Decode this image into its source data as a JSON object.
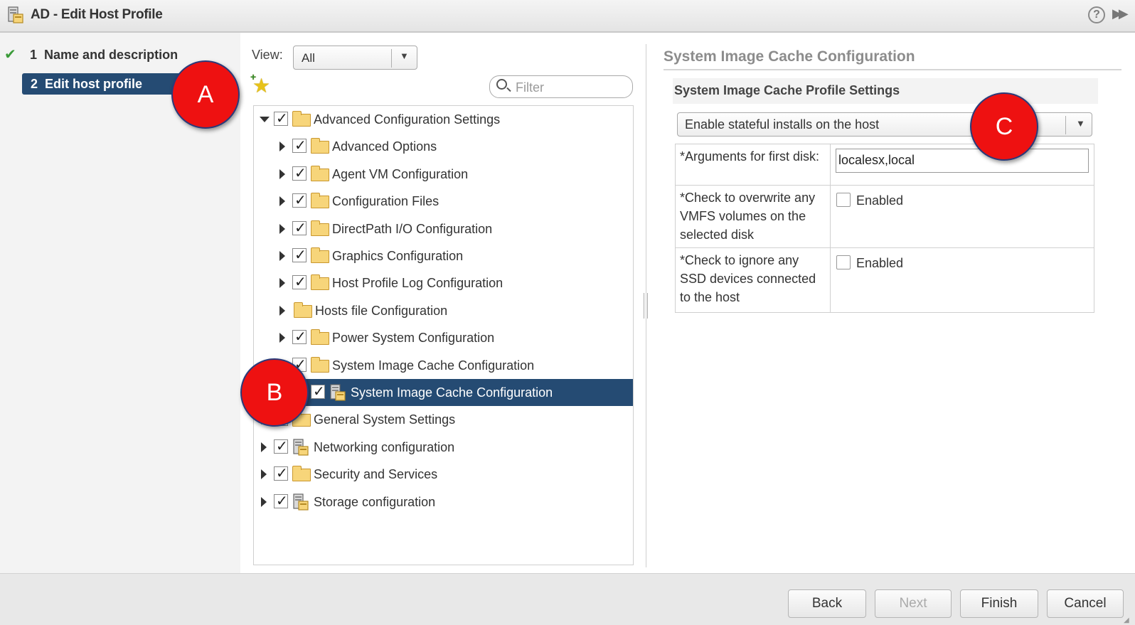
{
  "window": {
    "title": "AD - Edit Host Profile",
    "help_label": "?",
    "expand_label": "▶▶"
  },
  "steps": [
    {
      "number": "1",
      "label": "Name and description",
      "completed": true
    },
    {
      "number": "2",
      "label": "Edit host profile",
      "active": true
    }
  ],
  "markers": [
    "A",
    "B",
    "C"
  ],
  "tree_panel": {
    "view_label": "View:",
    "view_value": "All",
    "filter_placeholder": "Filter",
    "nodes": [
      {
        "label": "Advanced Configuration Settings",
        "level": 0,
        "expanded": true,
        "checked": true,
        "icon": "folder-icon"
      },
      {
        "label": "Advanced Options",
        "level": 1,
        "expanded": false,
        "checked": true,
        "icon": "folder-icon"
      },
      {
        "label": "Agent VM Configuration",
        "level": 1,
        "expanded": false,
        "checked": true,
        "icon": "folder-icon"
      },
      {
        "label": "Configuration Files",
        "level": 1,
        "expanded": false,
        "checked": true,
        "icon": "folder-icon"
      },
      {
        "label": "DirectPath I/O Configuration",
        "level": 1,
        "expanded": false,
        "checked": true,
        "icon": "folder-icon"
      },
      {
        "label": "Graphics Configuration",
        "level": 1,
        "expanded": false,
        "checked": true,
        "icon": "folder-icon"
      },
      {
        "label": "Host Profile Log Configuration",
        "level": 1,
        "expanded": false,
        "checked": true,
        "icon": "folder-icon"
      },
      {
        "label": "Hosts file Configuration",
        "level": 1,
        "expanded": false,
        "checked": false,
        "icon": "folder-icon"
      },
      {
        "label": "Power System Configuration",
        "level": 1,
        "expanded": false,
        "checked": true,
        "icon": "folder-icon"
      },
      {
        "label": "System Image Cache Configuration",
        "level": 1,
        "expanded": true,
        "checked": true,
        "icon": "folder-icon"
      },
      {
        "label": "System Image Cache Configuration",
        "level": 2,
        "checked": true,
        "icon": "host-profile-icon",
        "selected": true
      },
      {
        "label": "General System Settings",
        "level": 0,
        "expanded": false,
        "checked": true,
        "icon": "folder-icon"
      },
      {
        "label": "Networking configuration",
        "level": 0,
        "expanded": false,
        "checked": true,
        "icon": "host-profile-icon"
      },
      {
        "label": "Security and Services",
        "level": 0,
        "expanded": false,
        "checked": true,
        "icon": "folder-icon"
      },
      {
        "label": "Storage configuration",
        "level": 0,
        "expanded": false,
        "checked": true,
        "icon": "host-profile-icon"
      }
    ]
  },
  "config_panel": {
    "title": "System Image Cache Configuration",
    "section_title": "System Image Cache Profile Settings",
    "profile_option": "Enable stateful installs on the host",
    "params": [
      {
        "label": "*Arguments for first disk:",
        "type": "text",
        "value": "localesx,local"
      },
      {
        "label": "*Check to overwrite any VMFS volumes on the selected disk",
        "type": "checkbox",
        "checkbox_label": "Enabled",
        "checked": false
      },
      {
        "label": "*Check to ignore any SSD devices connected to the host",
        "type": "checkbox",
        "checkbox_label": "Enabled",
        "checked": false
      }
    ]
  },
  "footer": {
    "back_label": "Back",
    "next_label": "Next",
    "finish_label": "Finish",
    "cancel_label": "Cancel"
  },
  "colors": {
    "selection": "#254b73",
    "marker": "#ee1111",
    "check_green": "#3b9b39"
  }
}
